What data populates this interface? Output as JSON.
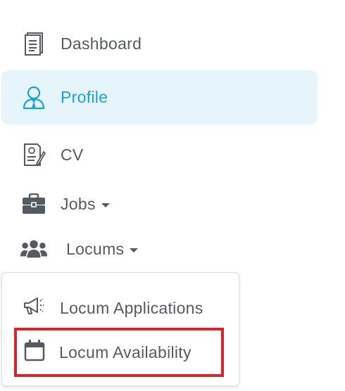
{
  "nav": {
    "items": [
      {
        "label": "Dashboard",
        "icon": "document-icon"
      },
      {
        "label": "Profile",
        "icon": "user-tie-icon",
        "active": true,
        "accent": "#1ba1d8",
        "highlight": "#e6f4fb"
      },
      {
        "label": "CV",
        "icon": "resume-icon"
      },
      {
        "label": "Jobs",
        "icon": "briefcase-icon"
      },
      {
        "label": "Locums",
        "icon": "users-icon"
      }
    ]
  },
  "locums_menu": {
    "items": [
      {
        "label": "Locum Applications",
        "icon": "megaphone-icon"
      },
      {
        "label": "Locum Availability",
        "icon": "calendar-icon",
        "highlight_border": "#d9232d"
      }
    ]
  }
}
